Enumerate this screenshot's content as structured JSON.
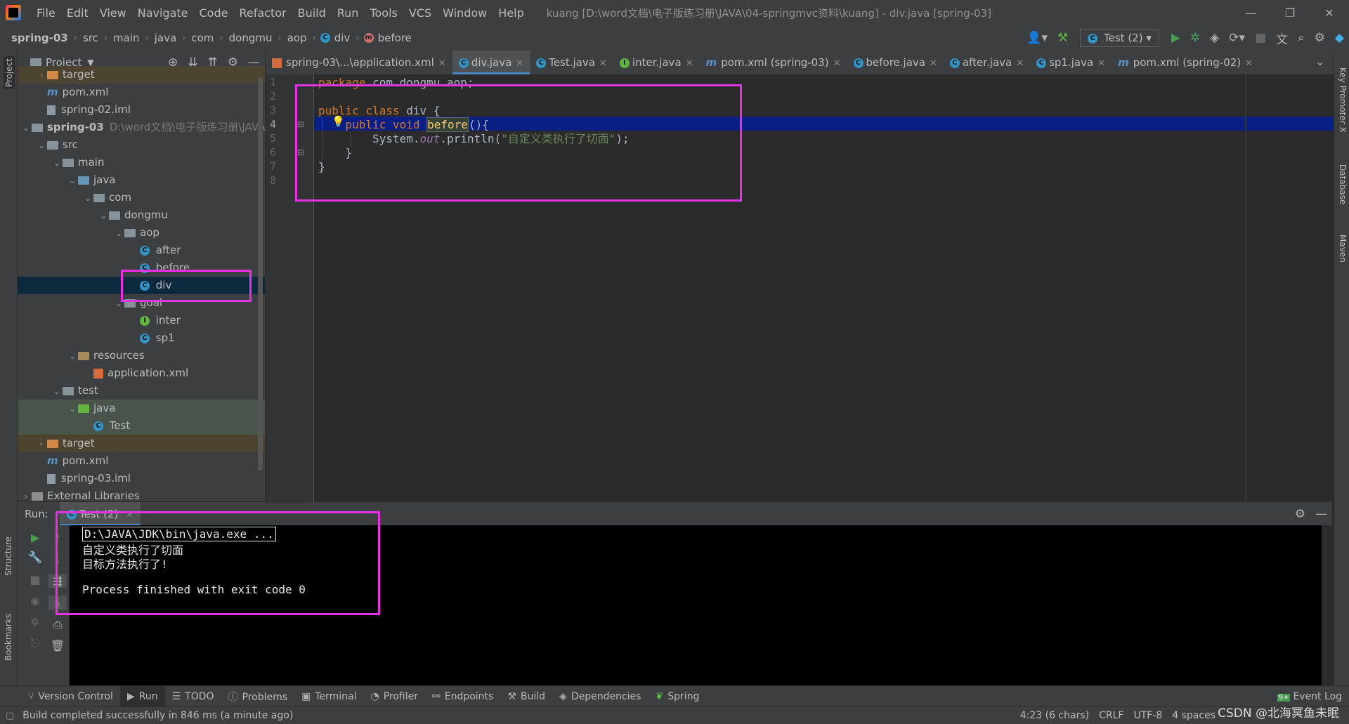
{
  "menu": {
    "items": [
      "File",
      "Edit",
      "View",
      "Navigate",
      "Code",
      "Refactor",
      "Build",
      "Run",
      "Tools",
      "VCS",
      "Window",
      "Help"
    ],
    "window_title": "kuang [D:\\word文档\\电子版练习册\\JAVA\\04-springmvc资料\\kuang] - div.java [spring-03]"
  },
  "breadcrumbs": [
    "spring-03",
    "src",
    "main",
    "java",
    "com",
    "dongmu",
    "aop",
    "div",
    "before"
  ],
  "run_config": "Test (2)",
  "project": {
    "title": "Project",
    "tree": [
      {
        "label": "target",
        "indent": 1,
        "arrow": "›",
        "icon": "folder-orange",
        "cls": "excl"
      },
      {
        "label": "pom.xml",
        "indent": 1,
        "arrow": "",
        "icon": "maven",
        "cls": ""
      },
      {
        "label": "spring-02.iml",
        "indent": 1,
        "arrow": "",
        "icon": "iml",
        "cls": ""
      },
      {
        "label": "spring-03",
        "hint": "D:\\word文档\\电子版练习册\\JAVA",
        "indent": 0,
        "arrow": "⌄",
        "icon": "folder",
        "cls": "",
        "bold": true
      },
      {
        "label": "src",
        "indent": 1,
        "arrow": "⌄",
        "icon": "folder",
        "cls": ""
      },
      {
        "label": "main",
        "indent": 2,
        "arrow": "⌄",
        "icon": "folder",
        "cls": ""
      },
      {
        "label": "java",
        "indent": 3,
        "arrow": "⌄",
        "icon": "folder-src",
        "cls": ""
      },
      {
        "label": "com",
        "indent": 4,
        "arrow": "⌄",
        "icon": "folder",
        "cls": ""
      },
      {
        "label": "dongmu",
        "indent": 5,
        "arrow": "⌄",
        "icon": "folder",
        "cls": ""
      },
      {
        "label": "aop",
        "indent": 6,
        "arrow": "⌄",
        "icon": "folder",
        "cls": ""
      },
      {
        "label": "after",
        "indent": 7,
        "arrow": "",
        "icon": "class",
        "cls": ""
      },
      {
        "label": "before",
        "indent": 7,
        "arrow": "",
        "icon": "class",
        "cls": ""
      },
      {
        "label": "div",
        "indent": 7,
        "arrow": "",
        "icon": "class",
        "cls": "sel"
      },
      {
        "label": "goal",
        "indent": 6,
        "arrow": "⌄",
        "icon": "folder",
        "cls": ""
      },
      {
        "label": "inter",
        "indent": 7,
        "arrow": "",
        "icon": "interface",
        "cls": ""
      },
      {
        "label": "sp1",
        "indent": 7,
        "arrow": "",
        "icon": "class",
        "cls": ""
      },
      {
        "label": "resources",
        "indent": 3,
        "arrow": "⌄",
        "icon": "folder-res",
        "cls": ""
      },
      {
        "label": "application.xml",
        "indent": 4,
        "arrow": "",
        "icon": "xml",
        "cls": ""
      },
      {
        "label": "test",
        "indent": 2,
        "arrow": "⌄",
        "icon": "folder",
        "cls": ""
      },
      {
        "label": "java",
        "indent": 3,
        "arrow": "⌄",
        "icon": "folder-test",
        "cls": "test-bg"
      },
      {
        "label": "Test",
        "indent": 4,
        "arrow": "",
        "icon": "class",
        "cls": "test-bg"
      },
      {
        "label": "target",
        "indent": 1,
        "arrow": "›",
        "icon": "folder-orange",
        "cls": "excl"
      },
      {
        "label": "pom.xml",
        "indent": 1,
        "arrow": "",
        "icon": "maven",
        "cls": ""
      },
      {
        "label": "spring-03.iml",
        "indent": 1,
        "arrow": "",
        "icon": "iml",
        "cls": ""
      },
      {
        "label": "External Libraries",
        "indent": 0,
        "arrow": "›",
        "icon": "libs",
        "cls": ""
      }
    ]
  },
  "tabs": [
    {
      "label": "spring-03\\...\\application.xml",
      "icon": "xml"
    },
    {
      "label": "div.java",
      "icon": "class",
      "active": true
    },
    {
      "label": "Test.java",
      "icon": "class"
    },
    {
      "label": "inter.java",
      "icon": "interface"
    },
    {
      "label": "pom.xml (spring-03)",
      "icon": "maven"
    },
    {
      "label": "before.java",
      "icon": "class"
    },
    {
      "label": "after.java",
      "icon": "class"
    },
    {
      "label": "sp1.java",
      "icon": "class"
    },
    {
      "label": "pom.xml (spring-02)",
      "icon": "maven"
    }
  ],
  "editor": {
    "line_numbers": [
      "1",
      "2",
      "3",
      "4",
      "5",
      "6",
      "7",
      "8"
    ],
    "lines": {
      "l1_kw": "package",
      "l1_rest": " com.dongmu.aop;",
      "l3_kw": "public class",
      "l3_rest": " div {",
      "l4_kw": "public void",
      "l4_fn": "before",
      "l4_rest": "(){",
      "l5_a": "System.",
      "l5_out": "out",
      "l5_b": ".println(",
      "l5_str": "\"自定义类执行了切面\"",
      "l5_c": ");",
      "l6": "}",
      "l7": "}"
    }
  },
  "run": {
    "label": "Run:",
    "tab": "Test (2)",
    "console": [
      "D:\\JAVA\\JDK\\bin\\java.exe ...",
      "自定义类执行了切面",
      "目标方法执行了!",
      "",
      "Process finished with exit code 0"
    ]
  },
  "tool_tabs": [
    "Version Control",
    "Run",
    "TODO",
    "Problems",
    "Terminal",
    "Profiler",
    "Endpoints",
    "Build",
    "Dependencies",
    "Spring"
  ],
  "event_log": "Event Log",
  "event_badge": "9+",
  "status": {
    "message": "Build completed successfully in 846 ms (a minute ago)",
    "position": "4:23 (6 chars)",
    "line_sep": "CRLF",
    "encoding": "UTF-8",
    "indent": "4 spaces"
  },
  "side_labels": {
    "left": [
      "Project",
      "Structure",
      "Bookmarks"
    ],
    "right": [
      "Key Promoter X",
      "Database",
      "Maven"
    ]
  },
  "watermark": "CSDN @北海冥鱼未眠",
  "colors": {
    "annotation": "#e532e5",
    "accent": "#4a88c7",
    "caret_line": "#0a1f84"
  }
}
